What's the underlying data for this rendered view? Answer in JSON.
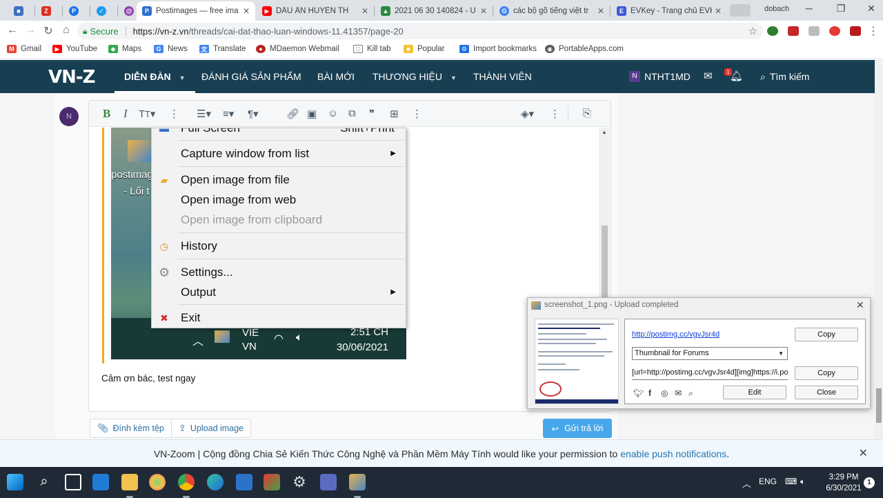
{
  "browser": {
    "tabs": [
      {
        "title": "",
        "fav_color": "#3b6fc6",
        "fav_glyph": "■"
      },
      {
        "title": "",
        "fav_color": "#d93025",
        "fav_glyph": "Z"
      },
      {
        "title": "",
        "fav_color": "#1a73e8",
        "fav_glyph": "P"
      },
      {
        "title": "",
        "fav_color": "#1d9bf0",
        "fav_glyph": "✓"
      },
      {
        "title": "",
        "fav_color": "#8e44ad",
        "fav_glyph": "@"
      },
      {
        "title": "Postimages — free ima",
        "fav_color": "#2e6fd1",
        "fav_glyph": "P"
      },
      {
        "title": "DẤU ẤN HUYỀN TH",
        "fav_color": "#ff0000",
        "fav_glyph": "▶"
      },
      {
        "title": "2021 06 30 140824 - U",
        "fav_color": "#2b8a3e",
        "fav_glyph": "▲"
      },
      {
        "title": "các bộ gõ tiếng việt tr",
        "fav_color": "#4285f4",
        "fav_glyph": "G"
      },
      {
        "title": "EVKey - Trang chủ EVK",
        "fav_color": "#3b5bdb",
        "fav_glyph": "E"
      }
    ],
    "window_user": "dobach",
    "omnibox": {
      "secure_label": "Secure",
      "url_host": "https://vn-z.vn",
      "url_path": "/threads/cai-dat-thao-luan-windows-11.41357/page-20"
    },
    "bookmarks": [
      {
        "label": "Gmail",
        "color": "#ea4335",
        "glyph": "M"
      },
      {
        "label": "YouTube",
        "color": "#ff0000",
        "glyph": "▶"
      },
      {
        "label": "Maps",
        "color": "#34a853",
        "glyph": "◆"
      },
      {
        "label": "News",
        "color": "#4285f4",
        "glyph": "G"
      },
      {
        "label": "Translate",
        "color": "#4285f4",
        "glyph": "文"
      },
      {
        "label": "MDaemon Webmail",
        "color": "#b3261e",
        "glyph": "●"
      },
      {
        "label": "Kill tab",
        "color": "#ffffff",
        "glyph": "□"
      },
      {
        "label": "Popular",
        "color": "#f4c430",
        "glyph": "■"
      },
      {
        "label": "Import bookmarks",
        "color": "#1a73e8",
        "glyph": "⚙"
      },
      {
        "label": "PortableApps.com",
        "color": "#555555",
        "glyph": "◉"
      }
    ]
  },
  "site": {
    "logo": "VN-Z",
    "nav": [
      {
        "label": "DIỄN ĐÀN",
        "caret": true
      },
      {
        "label": "ĐÁNH GIÁ SẢN PHẨM",
        "caret": false
      },
      {
        "label": "BÀI MỚI",
        "caret": false
      },
      {
        "label": "THƯƠNG HIỆU",
        "caret": true
      },
      {
        "label": "THÀNH VIÊN",
        "caret": false
      }
    ],
    "user_initial": "N",
    "username": "NTHT1MD",
    "alert_count": "1",
    "search_label": "Tìm kiếm"
  },
  "post": {
    "avatar_initial": "N",
    "desktop_label_line1": "postimag",
    "desktop_label_line2": "- Lối t",
    "screenshot_taskbar": {
      "lang_line1": "VIE",
      "lang_line2": "VN",
      "time": "2:51 CH",
      "date": "30/06/2021"
    },
    "reply_text": "Cảm ơn bác, test ngay",
    "attach_label": "Đính kèm tệp",
    "upload_label": "Upload image",
    "submit_label": "Gửi trả lời"
  },
  "context_menu": {
    "items": [
      {
        "label": "Full Screen",
        "shortcut": "Shift+Print"
      },
      {
        "label": "Capture window from list",
        "submenu": "▶"
      },
      {
        "label": "Open image from file"
      },
      {
        "label": "Open image from web"
      },
      {
        "label": "Open image from clipboard"
      },
      {
        "label": "History"
      },
      {
        "label": "Settings..."
      },
      {
        "label": "Output",
        "submenu": "▶"
      },
      {
        "label": "Exit"
      }
    ]
  },
  "upload_dialog": {
    "title": "screenshot_1.png - Upload completed",
    "link": "http://postimg.cc/vgvJsr4d",
    "copy_label": "Copy",
    "format_selected": "Thumbnail for Forums",
    "code_value": "[url=http://postimg.cc/vgvJsr4d][img]https://i.po",
    "edit_label": "Edit",
    "close_label": "Close"
  },
  "notification": {
    "text": "VN-Zoom | Cộng đồng Chia Sẻ Kiến Thức Công Nghệ và Phần Mềm Máy Tính would like your permission to",
    "link": "enable push notifications",
    "suffix": "."
  },
  "taskbar": {
    "lang": "ENG",
    "time": "3:29 PM",
    "date": "6/30/2021",
    "notif_count": "1"
  }
}
